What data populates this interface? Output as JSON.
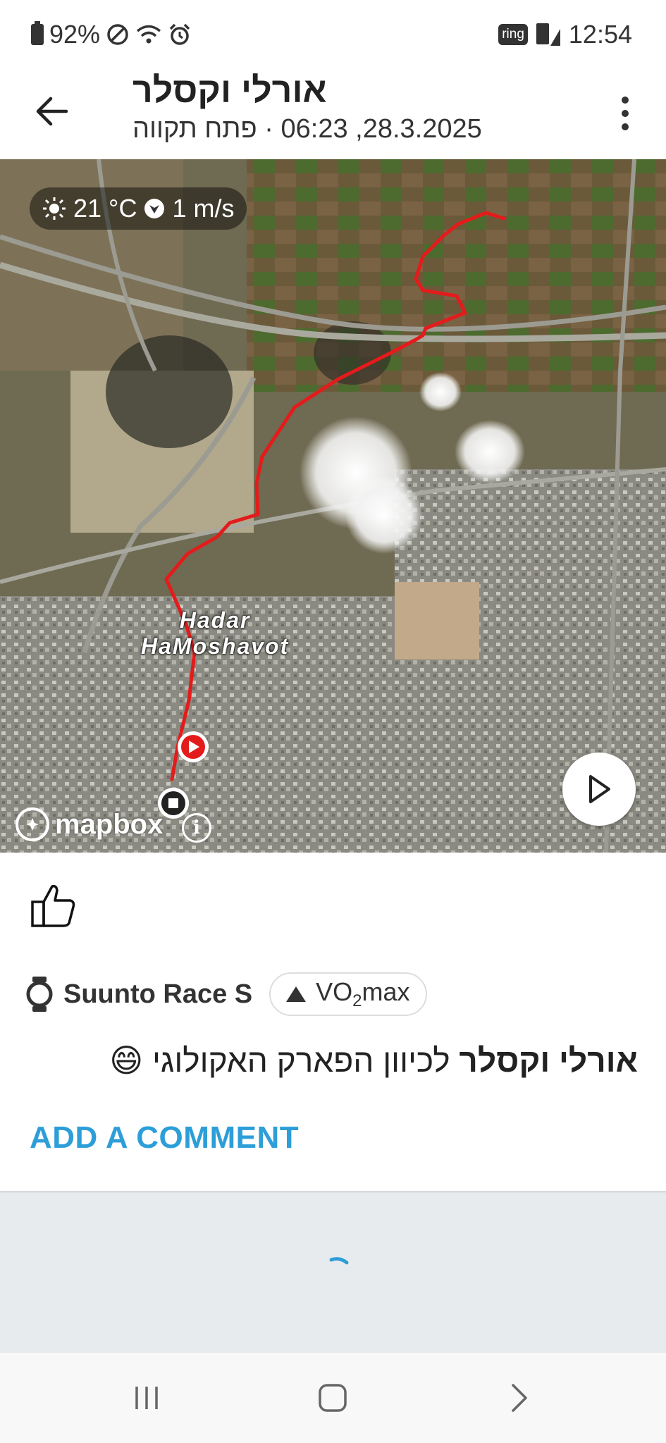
{
  "status_bar": {
    "battery": "92%",
    "ring_label": "ring",
    "time": "12:54"
  },
  "header": {
    "title": "אורלי וקסלר",
    "subtitle": "28.3.2025, 06:23 · פתח תקווה"
  },
  "map": {
    "weather_temp": "21 °C",
    "weather_wind": "1 m/s",
    "place_label_line1": "Hadar",
    "place_label_line2": "HaMoshavot",
    "attribution": "mapbox",
    "info_symbol": "i"
  },
  "activity": {
    "device": "Suunto Race S",
    "vo2_prefix": "VO",
    "vo2_sub": "2",
    "vo2_suffix": "max",
    "caption_author": "אורלי וקסלר",
    "caption_text": " לכיוון הפארק האקולוגי 😄",
    "add_comment": "ADD A COMMENT"
  },
  "colors": {
    "accent": "#2d9ed8",
    "route": "#e41b1b",
    "text": "#222222",
    "grey_background": "#e8ebee"
  },
  "icons": [
    "back-arrow-icon",
    "more-vertical-icon",
    "sun-icon",
    "wind-icon",
    "play-icon",
    "mapbox-logo-icon",
    "info-icon",
    "thumbs-up-icon",
    "watch-icon",
    "triangle-up-icon",
    "loading-spinner-icon",
    "recent-apps-icon",
    "home-icon",
    "forward-icon"
  ]
}
